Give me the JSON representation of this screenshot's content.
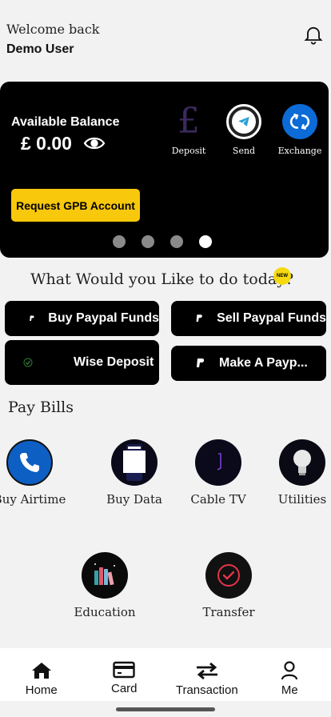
{
  "header": {
    "welcome": "Welcome back",
    "username": "Demo User"
  },
  "balance_card": {
    "label": "Available Balance",
    "amount": "£ 0.00",
    "actions": [
      {
        "label": "Deposit",
        "icon": "pound-icon"
      },
      {
        "label": "Send",
        "icon": "telegram-send-icon"
      },
      {
        "label": "Exchange",
        "icon": "exchange-icon"
      }
    ],
    "request_button": "Request GPB Account",
    "carousel_pages": 4,
    "carousel_active_index": 3
  },
  "quick_actions": {
    "question": "What Would you Like to do today?",
    "new_badge": "NEW",
    "buttons": [
      {
        "label": "Buy Paypal Funds"
      },
      {
        "label": "Sell Paypal Funds"
      },
      {
        "label": "Wise Deposit"
      },
      {
        "label": "Make A Payp..."
      }
    ]
  },
  "pay_bills": {
    "title": "Pay Bills",
    "items": [
      {
        "label": "Buy Airtime"
      },
      {
        "label": "Buy Data"
      },
      {
        "label": "Cable TV"
      },
      {
        "label": "Utilities"
      },
      {
        "label": "Education"
      },
      {
        "label": "Transfer"
      }
    ]
  },
  "nav": {
    "items": [
      {
        "label": "Home"
      },
      {
        "label": "Card"
      },
      {
        "label": "Transaction"
      },
      {
        "label": "Me"
      }
    ]
  },
  "colors": {
    "card_bg": "#000000",
    "accent_yellow": "#f7c80b",
    "exchange_blue": "#0c6bd6",
    "page_bg": "#f2f2f2"
  }
}
